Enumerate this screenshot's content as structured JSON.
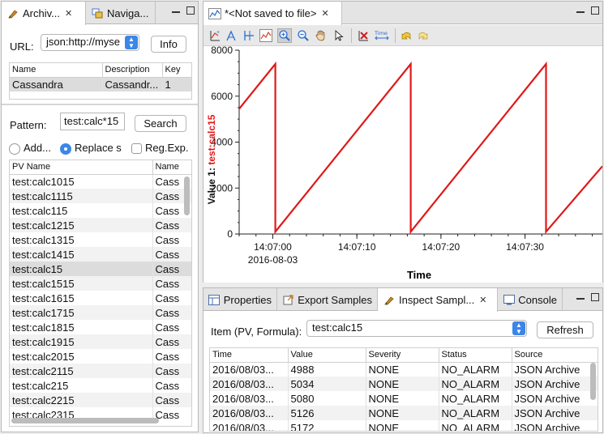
{
  "left": {
    "tabs": [
      {
        "label": "Archiv...",
        "icon": "archive-icon"
      },
      {
        "label": "Naviga...",
        "icon": "navigator-icon"
      }
    ],
    "url_label": "URL:",
    "url_value": "json:http://myse",
    "info_button": "Info",
    "archive_table": {
      "columns": [
        "Name",
        "Description",
        "Key"
      ],
      "rows": [
        [
          "Cassandra",
          "Cassandr...",
          "1"
        ]
      ]
    },
    "pattern_label": "Pattern:",
    "pattern_value": "test:calc*15",
    "search_button": "Search",
    "radio_add": "Add...",
    "radio_replace": "Replace s",
    "regexp_label": "Reg.Exp.",
    "pv_table": {
      "columns": [
        "PV Name",
        "Name"
      ],
      "rows": [
        [
          "test:calc1015",
          "Cass"
        ],
        [
          "test:calc1115",
          "Cass"
        ],
        [
          "test:calc115",
          "Cass"
        ],
        [
          "test:calc1215",
          "Cass"
        ],
        [
          "test:calc1315",
          "Cass"
        ],
        [
          "test:calc1415",
          "Cass"
        ],
        [
          "test:calc15",
          "Cass"
        ],
        [
          "test:calc1515",
          "Cass"
        ],
        [
          "test:calc1615",
          "Cass"
        ],
        [
          "test:calc1715",
          "Cass"
        ],
        [
          "test:calc1815",
          "Cass"
        ],
        [
          "test:calc1915",
          "Cass"
        ],
        [
          "test:calc2015",
          "Cass"
        ],
        [
          "test:calc2115",
          "Cass"
        ],
        [
          "test:calc215",
          "Cass"
        ],
        [
          "test:calc2215",
          "Cass"
        ],
        [
          "test:calc2315",
          "Cass"
        ]
      ],
      "selected_index": 6
    }
  },
  "editor": {
    "tab_title": "*<Not saved to file>",
    "toolbar_icons": [
      "add-axis-icon",
      "scale-icon",
      "stagger-icon",
      "chart-icon",
      "zoom-in-icon",
      "zoom-out-icon",
      "pan-icon",
      "pointer-icon",
      "remove-icon",
      "time-icon",
      "undo-icon",
      "redo-icon"
    ],
    "toolbar_time_text": "Time"
  },
  "chart_data": {
    "type": "line",
    "ylabel_prefix": "Value 1: ",
    "ylabel_series": "test:calc15",
    "xlabel": "Time",
    "ylim": [
      0,
      8000
    ],
    "yticks": [
      0,
      2000,
      4000,
      6000,
      8000
    ],
    "xticks": [
      "14:07:00",
      "14:07:10",
      "14:07:20",
      "14:07:30"
    ],
    "xtick_date": "2016-08-03",
    "series_color": "#e01818",
    "points": [
      [
        0,
        5450
      ],
      [
        4.3,
        7400
      ],
      [
        4.3,
        100
      ],
      [
        20.4,
        7400
      ],
      [
        20.4,
        100
      ],
      [
        36.5,
        7400
      ],
      [
        36.5,
        100
      ],
      [
        43.2,
        2950
      ]
    ],
    "x_offset_note": "x in seconds from 14:06:56"
  },
  "bottom": {
    "tabs": [
      {
        "label": "Properties",
        "icon": "properties-icon"
      },
      {
        "label": "Export Samples",
        "icon": "export-icon"
      },
      {
        "label": "Inspect Sampl...",
        "icon": "inspect-icon"
      },
      {
        "label": "Console",
        "icon": "console-icon"
      }
    ],
    "item_label": "Item (PV, Formula):",
    "item_value": "test:calc15",
    "refresh_button": "Refresh",
    "samples_table": {
      "columns": [
        "Time",
        "Value",
        "Severity",
        "Status",
        "Source"
      ],
      "rows": [
        [
          "2016/08/03...",
          "4988",
          "NONE",
          "NO_ALARM",
          "JSON Archive"
        ],
        [
          "2016/08/03...",
          "5034",
          "NONE",
          "NO_ALARM",
          "JSON Archive"
        ],
        [
          "2016/08/03...",
          "5080",
          "NONE",
          "NO_ALARM",
          "JSON Archive"
        ],
        [
          "2016/08/03...",
          "5126",
          "NONE",
          "NO_ALARM",
          "JSON Archive"
        ],
        [
          "2016/08/03...",
          "5172",
          "NONE",
          "NO_ALARM",
          "JSON Archive"
        ]
      ]
    }
  },
  "colors": {
    "accent": "#3b86ea",
    "series": "#e01818"
  }
}
